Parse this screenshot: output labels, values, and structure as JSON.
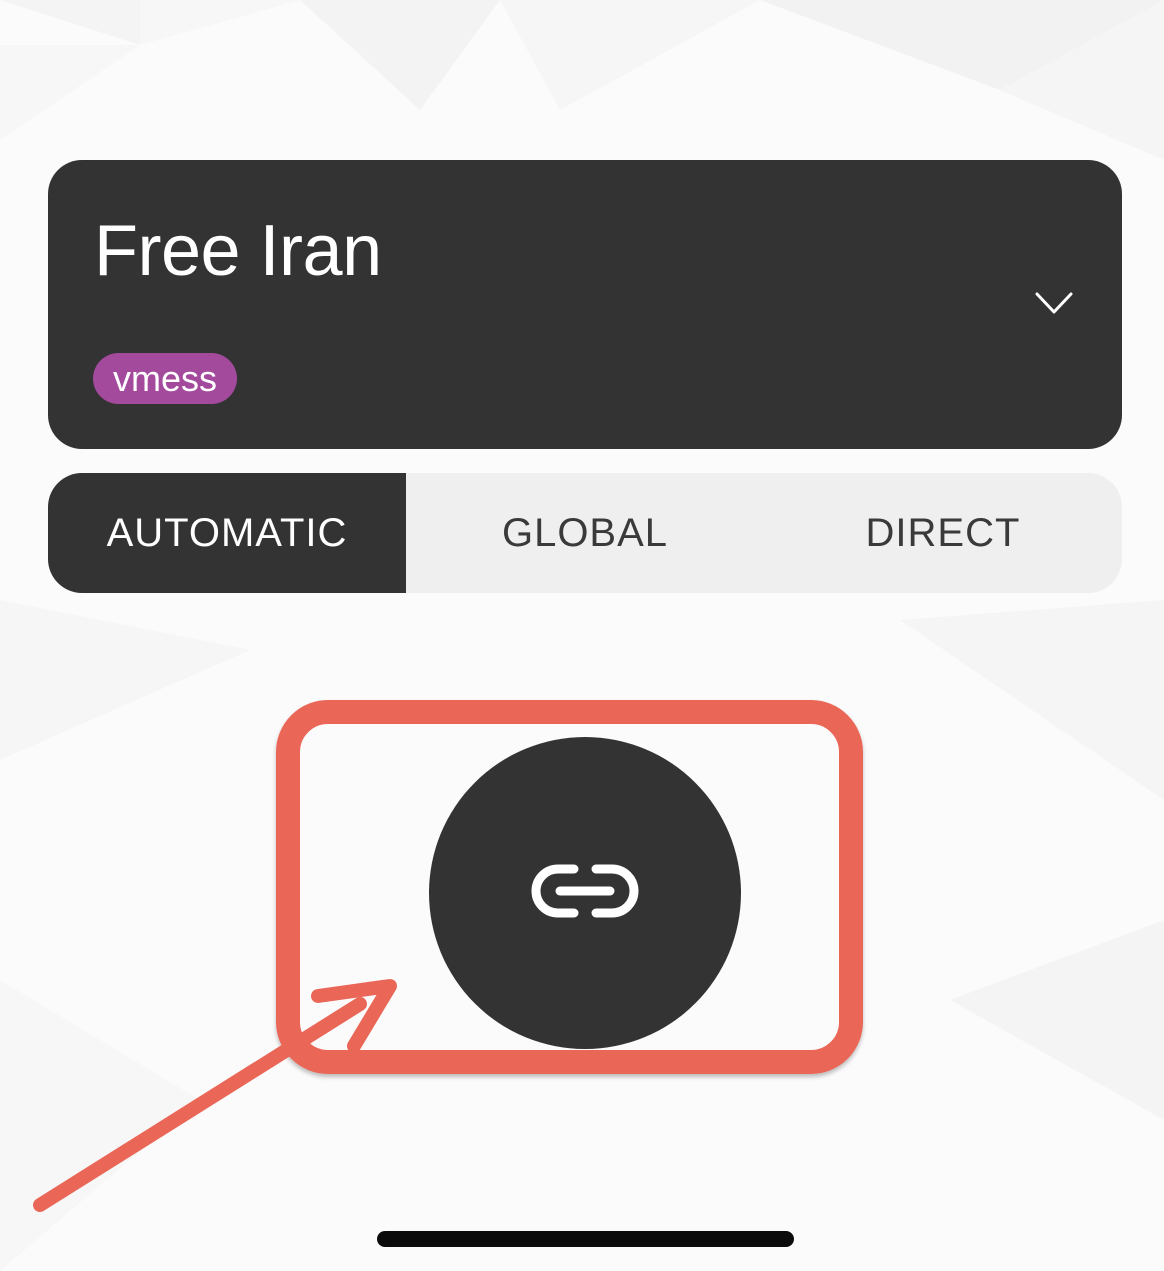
{
  "server": {
    "name": "Free Iran",
    "protocol": "vmess",
    "protocol_color": "#a44a9d",
    "dropdown_icon": "chevron-down-icon"
  },
  "routing_modes": {
    "selected": "AUTOMATIC",
    "tabs": [
      {
        "label": "AUTOMATIC"
      },
      {
        "label": "GLOBAL"
      },
      {
        "label": "DIRECT"
      }
    ]
  },
  "connect_button": {
    "icon": "link-icon",
    "state": "disconnected"
  },
  "annotation": {
    "color": "#ea6657",
    "shapes": [
      "highlight-box",
      "pointer-arrow"
    ]
  },
  "colors": {
    "card": "#333333",
    "segment_bg": "#efefef",
    "page_bg": "#fbfbfb"
  }
}
